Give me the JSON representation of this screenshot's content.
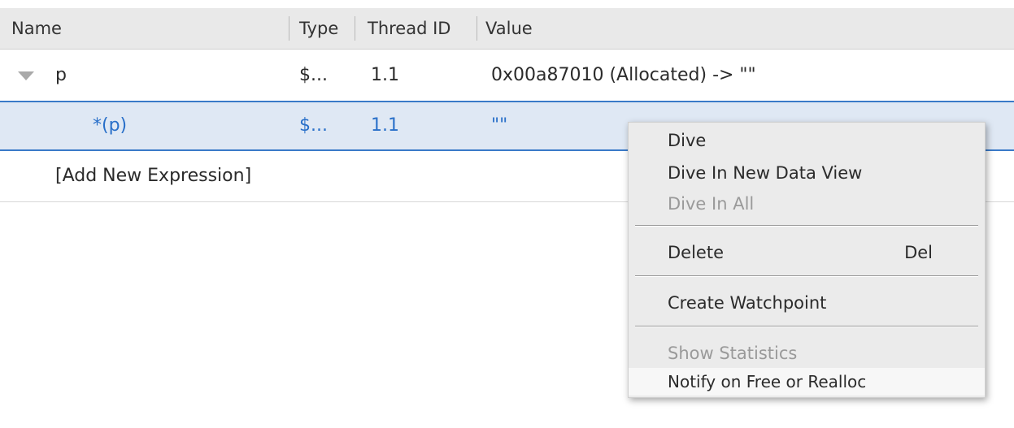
{
  "columns": {
    "name": "Name",
    "type": "Type",
    "thread_id": "Thread ID",
    "value": "Value"
  },
  "rows": [
    {
      "name": "p",
      "type": "$...",
      "thread_id": "1.1",
      "value": "0x00a87010 (Allocated) -> \"\"",
      "expanded": true
    },
    {
      "name": "*(p)",
      "type": "$...",
      "thread_id": "1.1",
      "value": "\"\"",
      "selected": true
    }
  ],
  "add_expression": "[Add New Expression]",
  "context_menu": {
    "items": [
      {
        "label": "Dive",
        "enabled": true
      },
      {
        "label": "Dive In New Data View",
        "enabled": true
      },
      {
        "label": "Dive In All",
        "enabled": false
      },
      {
        "label": "Delete",
        "shortcut": "Del",
        "enabled": true
      },
      {
        "label": "Create Watchpoint",
        "enabled": true
      },
      {
        "label": "Show Statistics",
        "enabled": false
      },
      {
        "label": "Notify on Free or Realloc",
        "enabled": true,
        "hovered": true
      }
    ]
  },
  "colors": {
    "selection_background": "#dfe8f4",
    "selection_border": "#3a7ac8",
    "selection_text": "#2a70c9",
    "header_background": "#e9e9e9",
    "menu_background": "#ebebeb"
  }
}
